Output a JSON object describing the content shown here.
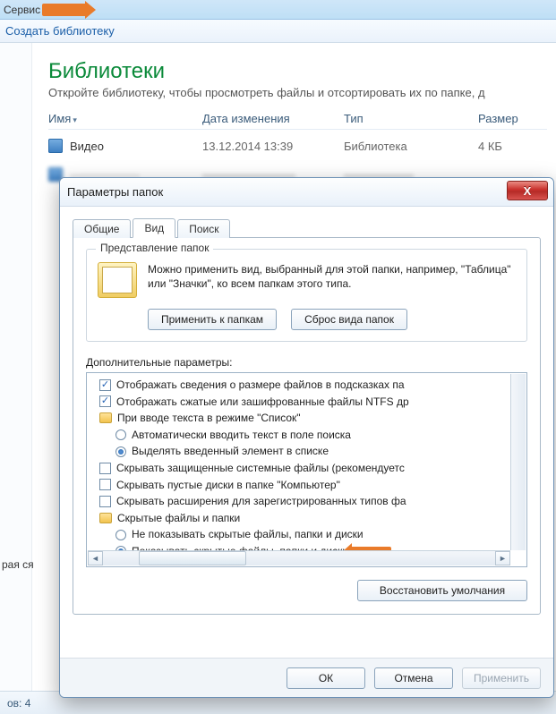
{
  "topbar": {
    "menu_service": "Сервис"
  },
  "cmdbar": {
    "create_library": "Создать библиотеку"
  },
  "library": {
    "title": "Библиотеки",
    "subtitle": "Откройте библиотеку, чтобы просмотреть файлы и отсортировать их по папке, д"
  },
  "columns": {
    "name": "Имя",
    "date": "Дата изменения",
    "type": "Тип",
    "size": "Размер"
  },
  "row_video": {
    "name": "Видео",
    "date": "13.12.2014 13:39",
    "type": "Библиотека",
    "size": "4 КБ"
  },
  "sidebar_hint": "рая ся",
  "statusbar": {
    "count_label": "ов: 4"
  },
  "dialog": {
    "title": "Параметры папок",
    "close": "X",
    "tabs": {
      "general": "Общие",
      "view": "Вид",
      "search": "Поиск"
    },
    "group": {
      "legend": "Представление папок",
      "text": "Можно применить вид, выбранный для этой папки, например, \"Таблица\" или \"Значки\", ко всем папкам этого типа.",
      "apply_btn": "Применить к папкам",
      "reset_btn": "Сброс вида папок"
    },
    "adv_label": "Дополнительные параметры:",
    "opts": {
      "o1": "Отображать сведения о размере файлов в подсказках па",
      "o2": "Отображать сжатые или зашифрованные файлы NTFS др",
      "g1": "При вводе текста в режиме \"Список\"",
      "r1a": "Автоматически вводить текст в поле поиска",
      "r1b": "Выделять введенный элемент в списке",
      "o3": "Скрывать защищенные системные файлы (рекомендуетс",
      "o4": "Скрывать пустые диски в папке \"Компьютер\"",
      "o5": "Скрывать расширения для зарегистрированных типов фа",
      "g2": "Скрытые файлы и папки",
      "r2a": "Не показывать скрытые файлы, папки и диски",
      "r2b": "Показывать скрытые файлы, папки и диски"
    },
    "restore_btn": "Восстановить умолчания",
    "ok": "ОК",
    "cancel": "Отмена",
    "apply": "Применить"
  }
}
